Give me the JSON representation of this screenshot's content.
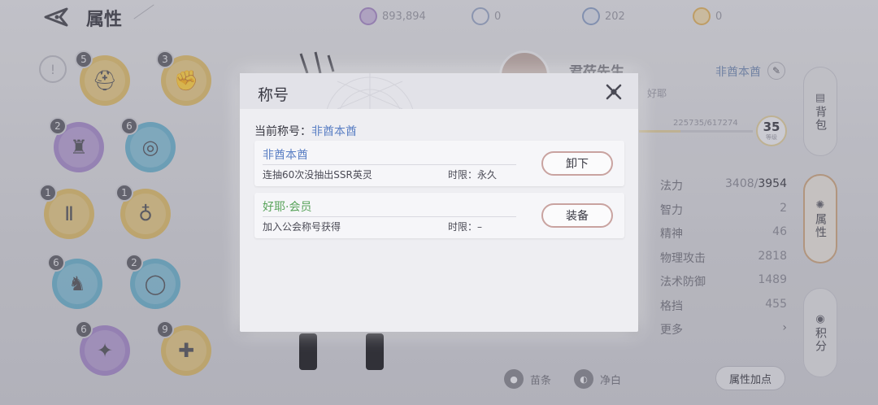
{
  "header": {
    "title": "属性",
    "currencies": [
      {
        "icon": "crystal-icon",
        "value": "893,894",
        "color": "#a58cc4"
      },
      {
        "icon": "coin-circle-icon",
        "value": "0",
        "color": "#9aa6c4"
      },
      {
        "icon": "shield-token-icon",
        "value": "202",
        "color": "#8fa0c4"
      },
      {
        "icon": "gold-coin-icon",
        "value": "0",
        "color": "#d8b06a"
      }
    ]
  },
  "equipment": {
    "sort_label": "!",
    "slots": [
      {
        "name": "helmet",
        "badge": "5",
        "glyph": "⛑",
        "color": "#d9b45a"
      },
      {
        "name": "gauntlet",
        "badge": "3",
        "glyph": "✊",
        "color": "#d9b45a"
      },
      {
        "name": "armor",
        "badge": "2",
        "glyph": "♜",
        "color": "#9b7cc4"
      },
      {
        "name": "necklace",
        "badge": "6",
        "glyph": "◎",
        "color": "#5aa8c8"
      },
      {
        "name": "pants",
        "badge": "1",
        "glyph": "Ⅱ",
        "color": "#d9b45a"
      },
      {
        "name": "amulet",
        "badge": "1",
        "glyph": "♁",
        "color": "#d9b45a"
      },
      {
        "name": "boots",
        "badge": "6",
        "glyph": "♞",
        "color": "#5aa8c8"
      },
      {
        "name": "ring",
        "badge": "2",
        "glyph": "◯",
        "color": "#5aa8c8"
      },
      {
        "name": "weapon-left",
        "badge": "6",
        "glyph": "✦",
        "color": "#9b7cc4"
      },
      {
        "name": "weapon-right",
        "badge": "9",
        "glyph": "✚",
        "color": "#d9b45a"
      }
    ]
  },
  "profile": {
    "name": "君莅先生",
    "guild": "好耶",
    "title_tag": "非酋本酋",
    "edit_icon": "pencil-icon",
    "exp_text": "225735/617274",
    "exp_fraction": 0.366,
    "level": "35",
    "level_sub": "等级"
  },
  "stats": {
    "mana_label": "法力",
    "mana_value": "3408/",
    "mana_max": "3954",
    "rows": [
      {
        "label": "智力",
        "value": "2"
      },
      {
        "label": "精神",
        "value": "46"
      },
      {
        "label": "物理攻击",
        "value": "2818"
      },
      {
        "label": "法术防御",
        "value": "1489"
      },
      {
        "label": "格挡",
        "value": "455"
      }
    ],
    "more_label": "更多",
    "more_arrow": "›"
  },
  "side_tabs": [
    {
      "label": "背包",
      "icon": "bag-icon",
      "glyph": "▤"
    },
    {
      "label": "属性",
      "icon": "attribute-icon",
      "glyph": "✺"
    },
    {
      "label": "积分",
      "icon": "points-icon",
      "glyph": "◉"
    }
  ],
  "bottom": {
    "btn1": "苗条",
    "btn1_icon": "●",
    "btn2": "净白",
    "btn2_icon": "◐",
    "attr_points": "属性加点"
  },
  "modal": {
    "title": "称号",
    "current_label": "当前称号：",
    "current_value": "非酋本酋",
    "cards": [
      {
        "name": "非酋本酋",
        "desc": "连抽60次没抽出SSR英灵",
        "limit": "时限：永久",
        "button": "卸下"
      },
      {
        "name": "好耶·会员",
        "desc": "加入公会称号获得",
        "limit": "时限：–",
        "button": "装备"
      }
    ]
  }
}
